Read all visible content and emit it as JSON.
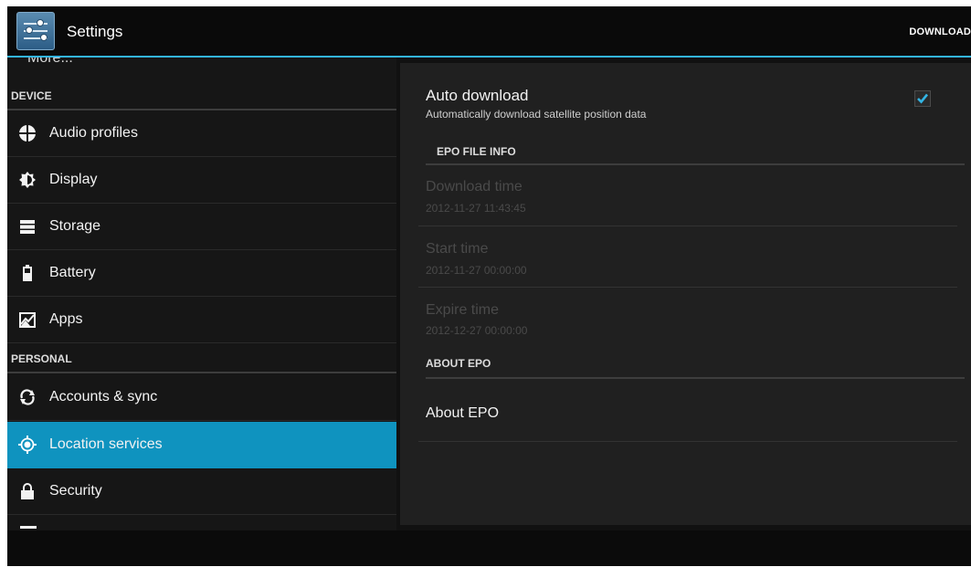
{
  "action_bar": {
    "title": "Settings",
    "app_icon": "settings-sliders-icon",
    "action": "DOWNLOAD"
  },
  "sidebar": {
    "partial_item": "More...",
    "sections": [
      {
        "header": "DEVICE",
        "items": [
          {
            "label": "Audio profiles",
            "icon": "audio-profiles-icon"
          },
          {
            "label": "Display",
            "icon": "display-brightness-icon"
          },
          {
            "label": "Storage",
            "icon": "storage-icon"
          },
          {
            "label": "Battery",
            "icon": "battery-icon"
          },
          {
            "label": "Apps",
            "icon": "apps-icon"
          }
        ]
      },
      {
        "header": "PERSONAL",
        "items": [
          {
            "label": "Accounts & sync",
            "icon": "sync-icon"
          },
          {
            "label": "Location services",
            "icon": "location-icon",
            "selected": true
          },
          {
            "label": "Security",
            "icon": "lock-icon"
          }
        ]
      }
    ]
  },
  "detail": {
    "auto_download": {
      "title": "Auto download",
      "summary": "Automatically download satellite position data",
      "checked": true
    },
    "epo_file_info": {
      "header": "EPO FILE INFO",
      "rows": [
        {
          "title": "Download time",
          "value": "2012-11-27 11:43:45"
        },
        {
          "title": "Start time",
          "value": "2012-11-27 00:00:00"
        },
        {
          "title": "Expire time",
          "value": "2012-12-27 00:00:00"
        }
      ]
    },
    "about_epo": {
      "header": "ABOUT EPO",
      "item": "About EPO"
    }
  },
  "colors": {
    "accent": "#33b5e5",
    "selected_bg": "#0f93bf",
    "background": "#111111"
  }
}
